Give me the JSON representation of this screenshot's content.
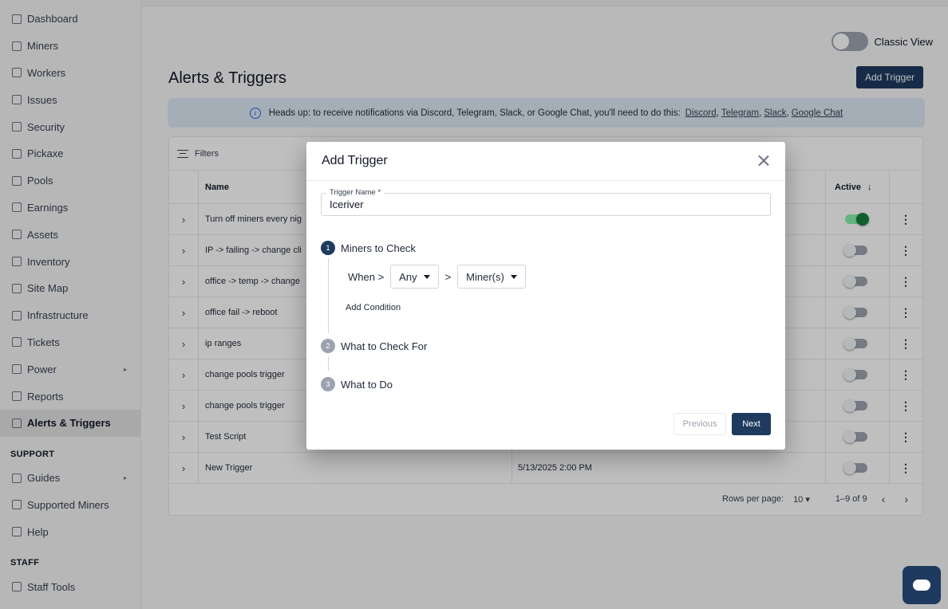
{
  "sidebar": {
    "items": [
      {
        "label": "Dashboard",
        "icon": "dashboard-icon"
      },
      {
        "label": "Miners",
        "icon": "miners-icon"
      },
      {
        "label": "Workers",
        "icon": "workers-icon"
      },
      {
        "label": "Issues",
        "icon": "warning-icon"
      },
      {
        "label": "Security",
        "icon": "shield-icon"
      },
      {
        "label": "Pickaxe",
        "icon": "pickaxe-icon"
      },
      {
        "label": "Pools",
        "icon": "pools-icon"
      },
      {
        "label": "Earnings",
        "icon": "earnings-icon"
      },
      {
        "label": "Assets",
        "icon": "assets-icon"
      },
      {
        "label": "Inventory",
        "icon": "inventory-icon"
      },
      {
        "label": "Site Map",
        "icon": "sitemap-icon"
      },
      {
        "label": "Infrastructure",
        "icon": "layers-icon"
      },
      {
        "label": "Tickets",
        "icon": "ticket-icon"
      },
      {
        "label": "Power",
        "icon": "bolt-icon"
      },
      {
        "label": "Reports",
        "icon": "reports-icon"
      },
      {
        "label": "Alerts & Triggers",
        "icon": "alert-icon"
      }
    ],
    "support_header": "SUPPORT",
    "support_items": [
      {
        "label": "Guides",
        "icon": "book-icon"
      },
      {
        "label": "Supported Miners",
        "icon": "list-icon"
      },
      {
        "label": "Help",
        "icon": "help-icon"
      }
    ],
    "staff_header": "STAFF",
    "staff_items": [
      {
        "label": "Staff Tools",
        "icon": "tools-icon"
      }
    ]
  },
  "header": {
    "classic_view_label": "Classic View",
    "page_title": "Alerts & Triggers",
    "add_trigger_label": "Add Trigger"
  },
  "banner": {
    "text": "Heads up: to receive notifications via Discord, Telegram, Slack, or Google Chat, you'll need to do this:",
    "links": [
      "Discord",
      "Telegram",
      "Slack",
      "Google Chat"
    ],
    "sep": ","
  },
  "table": {
    "filters_label": "Filters",
    "col_name": "Name",
    "col_active": "Active",
    "col_active_sort": "↓",
    "rows": [
      {
        "name": "Turn off miners every nig",
        "date": "",
        "active": true
      },
      {
        "name": "IP -> failing -> change cli",
        "date": "",
        "active": false
      },
      {
        "name": "office -> temp -> change",
        "date": "",
        "active": false
      },
      {
        "name": "office fail -> reboot",
        "date": "",
        "active": false
      },
      {
        "name": "ip ranges",
        "date": "",
        "active": false
      },
      {
        "name": "change pools trigger",
        "date": "",
        "active": false
      },
      {
        "name": "change pools trigger",
        "date": "",
        "active": false
      },
      {
        "name": "Test Script",
        "date": "",
        "active": false
      },
      {
        "name": "New Trigger",
        "date": "5/13/2025 2:00 PM",
        "active": false
      }
    ],
    "expand_glyph": "›",
    "more_glyph": "⋮",
    "rows_per_page_label": "Rows per page:",
    "rows_per_page_value": "10 ▾",
    "range": "1–9 of 9",
    "prev_glyph": "‹",
    "next_glyph": "›"
  },
  "modal": {
    "title": "Add Trigger",
    "name_label": "Trigger Name *",
    "name_value": "Iceriver",
    "step1_num": "1",
    "step1_label": "Miners to Check",
    "when_label": "When >",
    "any_value": "Any",
    "gt": ">",
    "miners_value": "Miner(s)",
    "add_condition_label": "Add Condition",
    "step2_num": "2",
    "step2_label": "What to Check For",
    "step3_num": "3",
    "step3_label": "What to Do",
    "previous_label": "Previous",
    "next_label": "Next"
  }
}
